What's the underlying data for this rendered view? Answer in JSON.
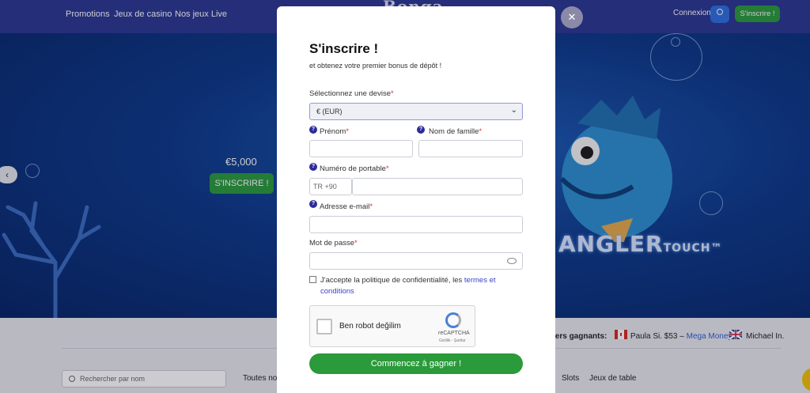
{
  "nav": {
    "links": [
      "Promotions",
      "Jeux de casino",
      "Nos jeux Live"
    ],
    "logo": "Bonga",
    "login": "Connexion",
    "signup": "S'inscrire !"
  },
  "hero": {
    "amount": "€5,000",
    "cta": "S'INSCRIRE !",
    "slot_logo": "ANGLER",
    "slot_logo_suffix": "TOUCH™"
  },
  "lower": {
    "winners_label": "rniers gagnants:",
    "winner1_name": "Paula Si. $53 – ",
    "winner1_game": "Mega Money",
    "winner2_name": "Michael In.",
    "search_placeholder": "Rechercher par nom",
    "categories": [
      "Toutes nos",
      "Slots",
      "Jeux de table"
    ]
  },
  "modal": {
    "close": "✕",
    "title": "S'inscrire !",
    "subtitle": "et obtenez votre premier bonus de dépôt !",
    "currency_label": "Sélectionnez une devise",
    "currency_value": "€ (EUR)",
    "first_name_label": "Prénom",
    "last_name_label": "Nom de famille",
    "phone_label": "Numéro de portable",
    "phone_prefix": "TR +90",
    "email_label": "Adresse e-mail",
    "password_label": "Mot de passe",
    "required_mark": "*",
    "info_glyph": "?",
    "consent_text": "J'accepte la politique de confidentialité, les ",
    "consent_link": "termes et conditions",
    "captcha_text": "Ben robot değilim",
    "captcha_brand": "reCAPTCHA",
    "captcha_terms": "Gizlilik - Şartlar",
    "submit": "Commencez à gagner !"
  },
  "colors": {
    "nav_bg": "#2a3690",
    "accent_green": "#2a9a3a",
    "link_blue": "#3a43c8"
  }
}
